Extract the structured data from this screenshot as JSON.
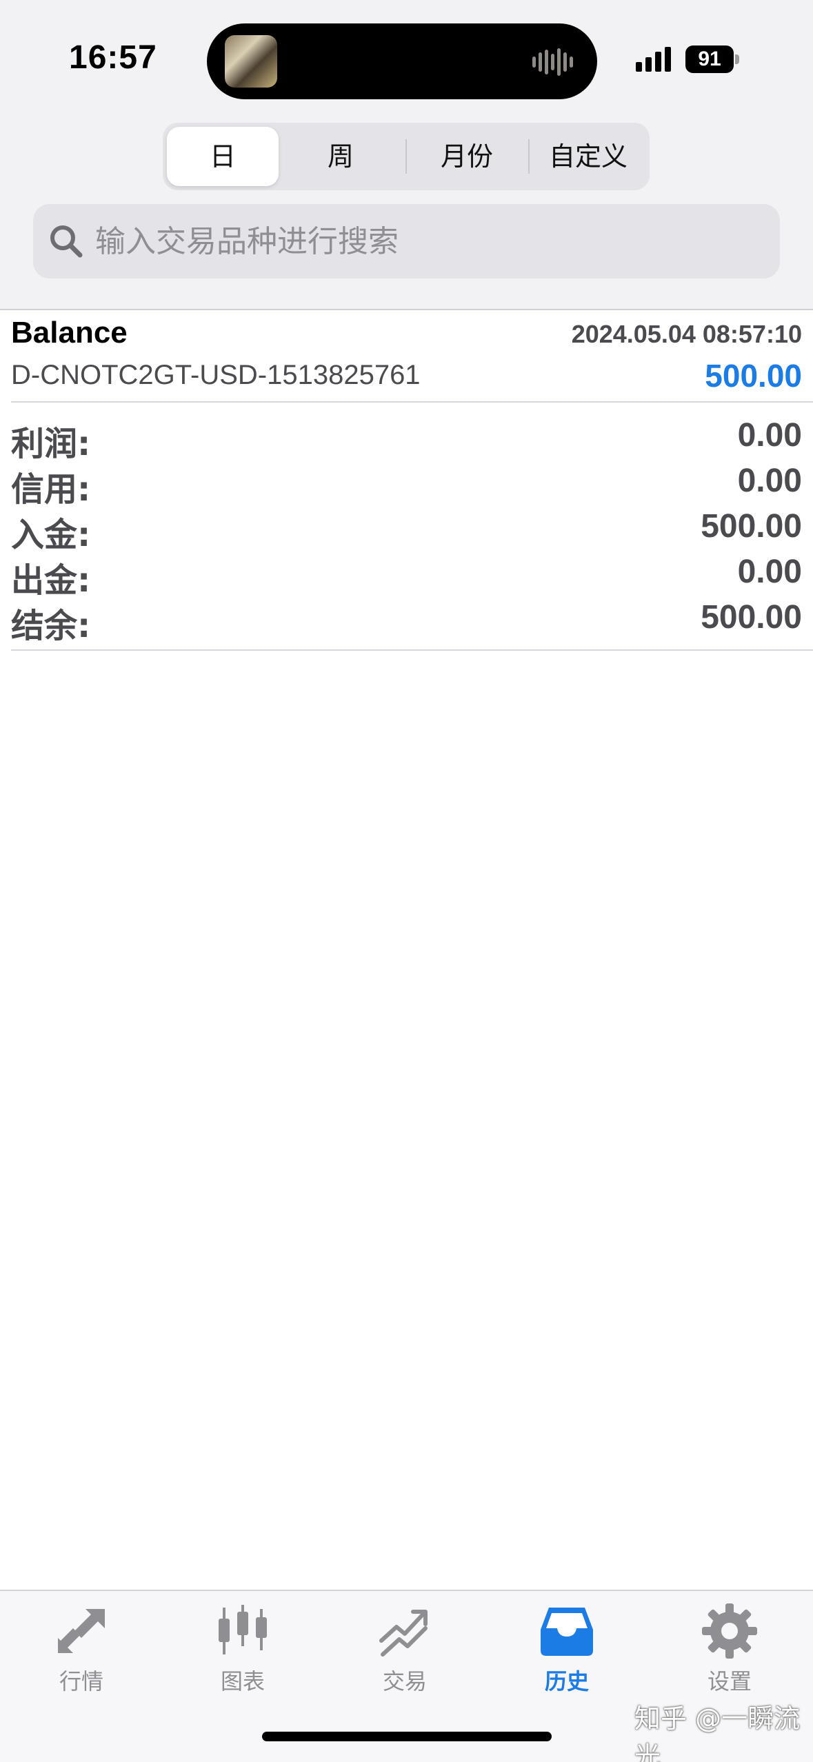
{
  "status_bar": {
    "time": "16:57",
    "battery": "91"
  },
  "period_tabs": [
    "日",
    "周",
    "月份",
    "自定义"
  ],
  "selected_period": "日",
  "search": {
    "placeholder": "输入交易品种进行搜索"
  },
  "entry": {
    "type": "Balance",
    "datetime": "2024.05.04 08:57:10",
    "account": "D-CNOTC2GT-USD-1513825761",
    "amount": "500.00"
  },
  "summary": [
    {
      "label": "利润:",
      "value": "0.00"
    },
    {
      "label": "信用:",
      "value": "0.00"
    },
    {
      "label": "入金:",
      "value": "500.00"
    },
    {
      "label": "出金:",
      "value": "0.00"
    },
    {
      "label": "结余:",
      "value": "500.00"
    }
  ],
  "tab_bar": [
    {
      "label": "行情",
      "icon": "quotes-arrows-icon"
    },
    {
      "label": "图表",
      "icon": "candlestick-icon"
    },
    {
      "label": "交易",
      "icon": "trade-trend-icon"
    },
    {
      "label": "历史",
      "icon": "inbox-tray-icon",
      "active": true
    },
    {
      "label": "设置",
      "icon": "gear-icon"
    }
  ],
  "watermark": "知乎 @一瞬流光",
  "colors": {
    "accent": "#1c7ce6",
    "muted": "#8e8e93",
    "text_secondary": "#4a4a4f"
  }
}
